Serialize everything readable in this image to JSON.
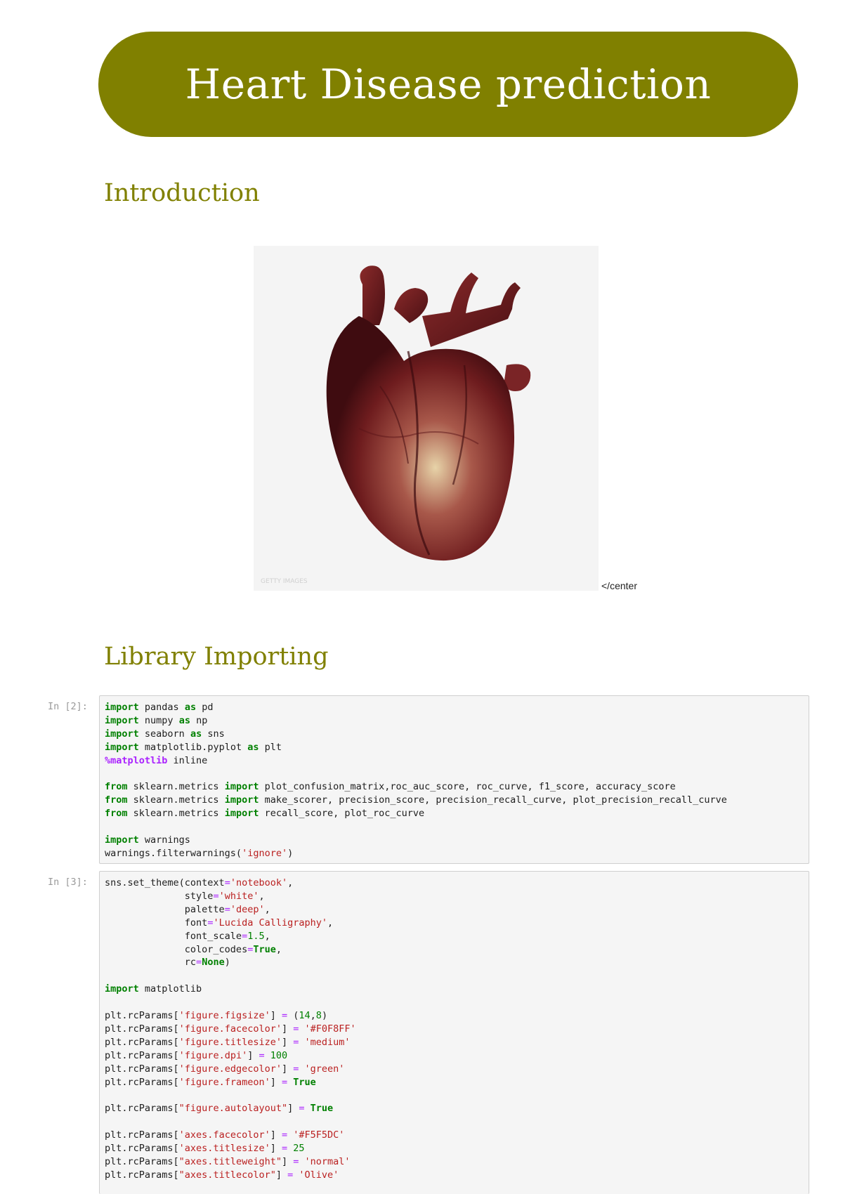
{
  "title": "Heart Disease prediction",
  "sections": {
    "introduction": "Introduction",
    "library_importing": "Library Importing"
  },
  "image": {
    "description_icon": "heart-image",
    "watermark": "GETTY IMAGES",
    "trailing_text": "</center"
  },
  "cells": [
    {
      "prompt": "In [2]:",
      "lines": [
        "import pandas as pd",
        "import numpy as np",
        "import seaborn as sns",
        "import matplotlib.pyplot as plt",
        "%matplotlib inline",
        "",
        "from sklearn.metrics import plot_confusion_matrix,roc_auc_score, roc_curve, f1_score, accuracy_score",
        "from sklearn.metrics import make_scorer, precision_score, precision_recall_curve, plot_precision_recall_curve",
        "from sklearn.metrics import recall_score, plot_roc_curve",
        "",
        "import warnings",
        "warnings.filterwarnings('ignore')"
      ]
    },
    {
      "prompt": "In [3]:",
      "lines": [
        "sns.set_theme(context='notebook',",
        "              style='white',",
        "              palette='deep',",
        "              font='Lucida Calligraphy',",
        "              font_scale=1.5,",
        "              color_codes=True,",
        "              rc=None)",
        "",
        "import matplotlib",
        "",
        "plt.rcParams['figure.figsize'] = (14,8)",
        "plt.rcParams['figure.facecolor'] = '#F0F8FF'",
        "plt.rcParams['figure.titlesize'] = 'medium'",
        "plt.rcParams['figure.dpi'] = 100",
        "plt.rcParams['figure.edgecolor'] = 'green'",
        "plt.rcParams['figure.frameon'] = True",
        "",
        "plt.rcParams[\"figure.autolayout\"] = True",
        "",
        "plt.rcParams['axes.facecolor'] = '#F5F5DC'",
        "plt.rcParams['axes.titlesize'] = 25",
        "plt.rcParams[\"axes.titleweight\"] = 'normal'",
        "plt.rcParams[\"axes.titlecolor\"] = 'Olive'"
      ]
    }
  ],
  "colors": {
    "banner": "#808000",
    "heading": "#808000",
    "cell_bg": "#f5f5f5",
    "keyword": "#008000",
    "string": "#ba2121",
    "magic": "#aa22ff"
  }
}
